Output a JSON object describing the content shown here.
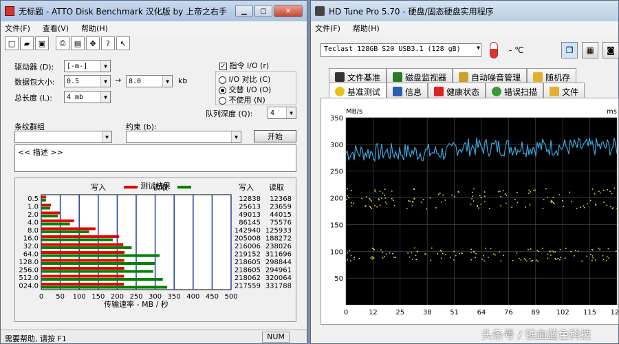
{
  "atto": {
    "title": "无标题 - ATTO Disk Benchmark 汉化版 by 上帝之右手",
    "menus": [
      "文件(F)",
      "查看(V)",
      "帮助(H)"
    ],
    "drive_label": "驱动器 (D):",
    "drive_value": "[-m-]",
    "size_label": "数据包大小:",
    "size_from": "0.5",
    "size_to": "8.0",
    "size_unit": "kb",
    "length_label": "总长度 (L):",
    "length_value": "4 mb",
    "force_write": "指令 I/O (r)",
    "io_compare": "I/O 对比 (C)",
    "overlapped": "交替 I/O (O)",
    "neither": "不使用 (N)",
    "queue_label": "队列深度 (Q):",
    "queue_value": "4",
    "stripe_label": "条纹群组",
    "control_label": "约束 (b):",
    "start_label": "开始",
    "description": "<< 描述 >>",
    "status": "需要帮助, 请按 F1",
    "num": "NUM"
  },
  "hdtune": {
    "title": "HD Tune Pro 5.70 - 硬盘/固态硬盘实用程序",
    "menus": [
      "文件(F)",
      "帮助(H)"
    ],
    "drive": "Teclast 128GB S20 USB3.1 (128 gB)",
    "temp": "- ℃",
    "tabs_top": [
      "文件基准",
      "磁盘监视器",
      "自动噪音管理",
      "随机存"
    ],
    "tabs_bottom": [
      "基准测试",
      "信息",
      "健康状态",
      "错误扫描",
      "文件"
    ]
  },
  "watermark": "头条号 / 铁血蓝色科技",
  "chart_data": [
    {
      "type": "bar",
      "title": "测试结果",
      "xlabel": "传输速率 - MB / 秒",
      "xlim": [
        0,
        500
      ],
      "xticks": [
        0,
        50,
        100,
        150,
        200,
        250,
        300,
        350,
        400,
        450,
        500
      ],
      "categories": [
        "0.5",
        "1.0",
        "2.0",
        "4.0",
        "8.0",
        "16.0",
        "32.0",
        "64.0",
        "128.0",
        "256.0",
        "512.0",
        "024.0"
      ],
      "series": [
        {
          "name": "写入",
          "color": "#e00000",
          "values": [
            12838,
            25613,
            49013,
            86145,
            142940,
            205008,
            216006,
            219152,
            218605,
            218605,
            218062,
            217559
          ]
        },
        {
          "name": "读取",
          "color": "#008000",
          "values": [
            12368,
            23659,
            44015,
            75576,
            125933,
            188272,
            238026,
            311696,
            298844,
            294961,
            320064,
            331788
          ]
        }
      ],
      "column_headers": [
        "写入",
        "读取"
      ]
    },
    {
      "type": "scatter",
      "ylabel_left": "MB/s",
      "ylabel_right": "ms",
      "ylim": [
        0,
        350
      ],
      "yticks": [
        50,
        100,
        150,
        200,
        250,
        300,
        350
      ],
      "xticks": [
        "0",
        "12",
        "25",
        "38",
        "51",
        "64",
        "76",
        "89",
        "102",
        "115",
        "128"
      ],
      "line_color": "#3aa8e0",
      "point_color": "#e8e84a",
      "grid": true
    }
  ]
}
